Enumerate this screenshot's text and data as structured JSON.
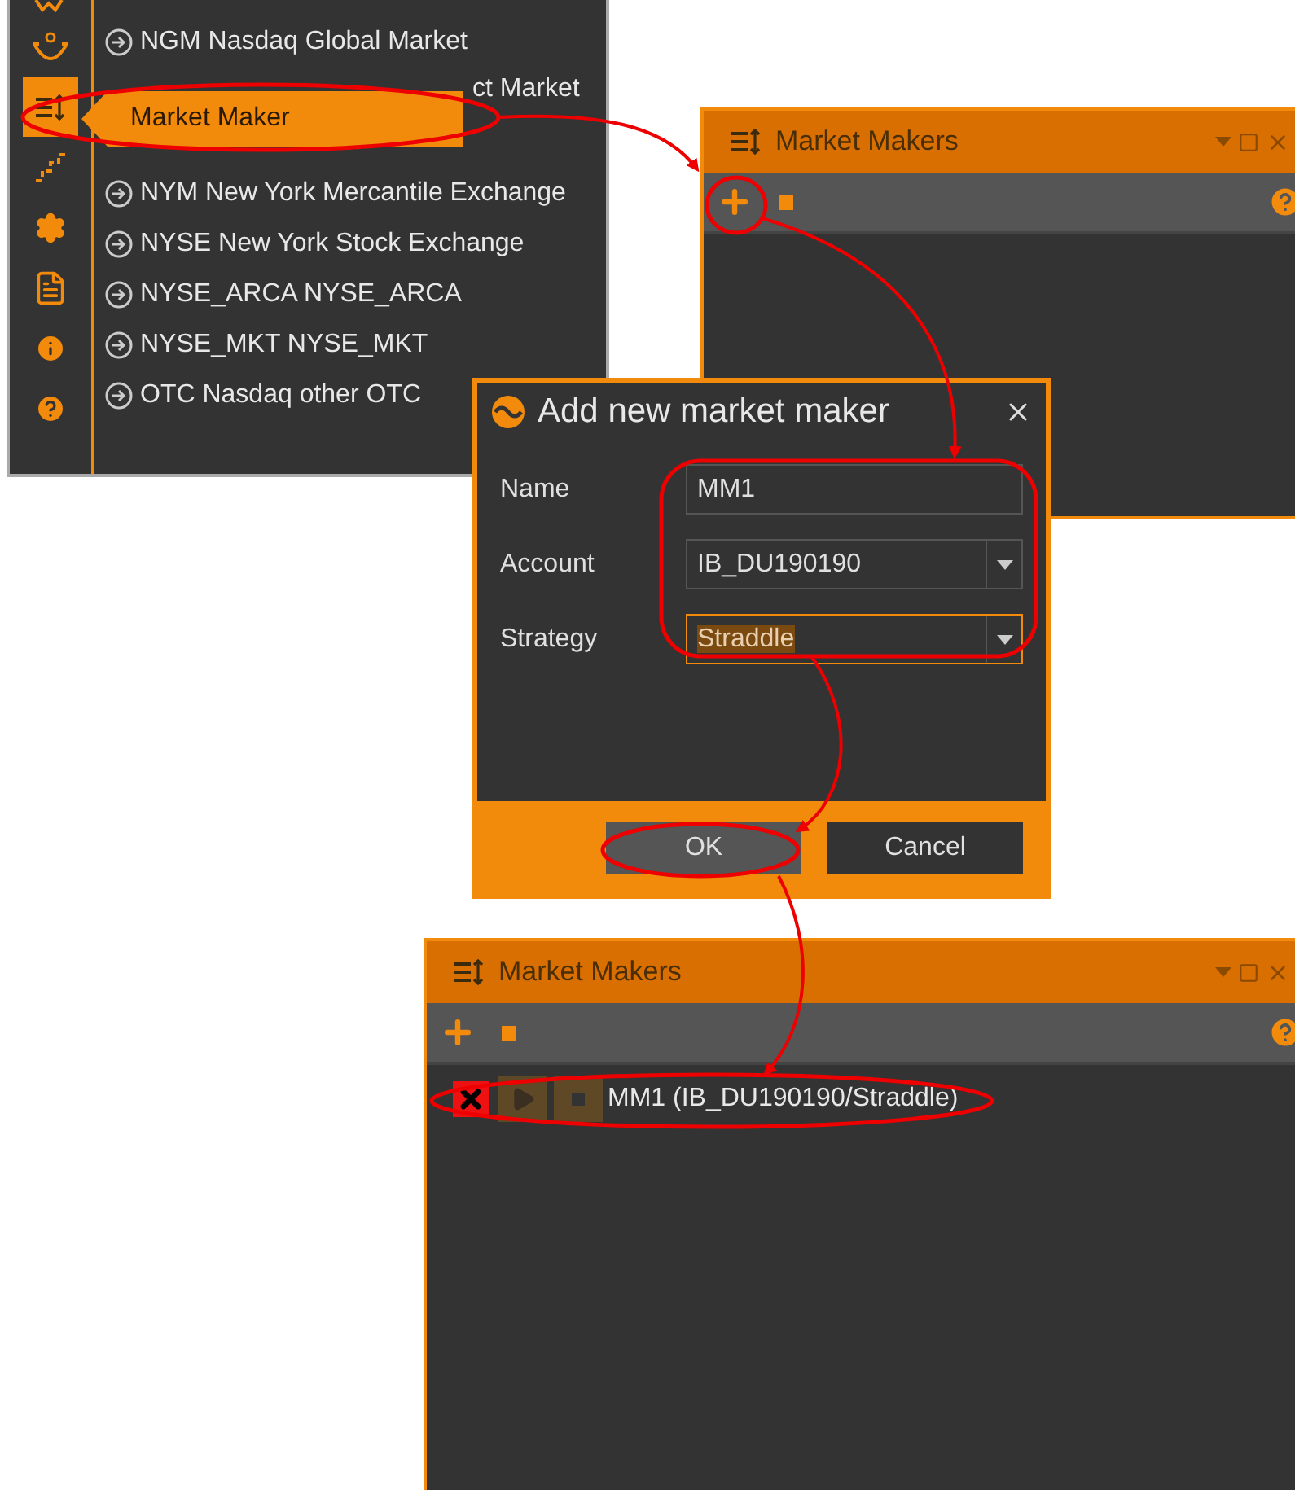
{
  "sidebar": {
    "icons": [
      {
        "kind": "chart",
        "selected": false
      },
      {
        "kind": "bowl",
        "selected": false
      },
      {
        "kind": "market-maker",
        "selected": true
      },
      {
        "kind": "stairs",
        "selected": false
      },
      {
        "kind": "gear",
        "selected": false
      },
      {
        "kind": "document",
        "selected": false
      },
      {
        "kind": "info",
        "selected": false
      },
      {
        "kind": "help",
        "selected": false
      }
    ]
  },
  "exchange_list": [
    {
      "label": "NGM Nasdaq Global Market",
      "kind": "full"
    },
    {
      "label": "ct Market",
      "kind": "covered"
    },
    {
      "label": "NYM New York Mercantile Exchange",
      "kind": "full"
    },
    {
      "label": "NYSE New York Stock Exchange",
      "kind": "full"
    },
    {
      "label": "NYSE_ARCA NYSE_ARCA",
      "kind": "full"
    },
    {
      "label": "NYSE_MKT NYSE_MKT",
      "kind": "full"
    },
    {
      "label": "OTC Nasdaq other OTC",
      "kind": "full"
    }
  ],
  "tooltip": "Market Maker",
  "market_makers_window": {
    "title": "Market Makers"
  },
  "dialog": {
    "title": "Add new market maker",
    "fields": [
      {
        "label": "Name",
        "value": "MM1",
        "kind": "text",
        "focused": false
      },
      {
        "label": "Account",
        "value": "IB_DU190190",
        "kind": "dropdown",
        "focused": false
      },
      {
        "label": "Strategy",
        "value": "Straddle",
        "kind": "dropdown",
        "focused": true
      }
    ],
    "buttons": [
      {
        "label": "OK",
        "selected": true
      },
      {
        "label": "Cancel",
        "selected": false
      }
    ]
  },
  "result_window": {
    "title": "Market Makers",
    "rows": [
      {
        "label": "MM1 (IB_DU190190/Straddle)"
      }
    ]
  }
}
